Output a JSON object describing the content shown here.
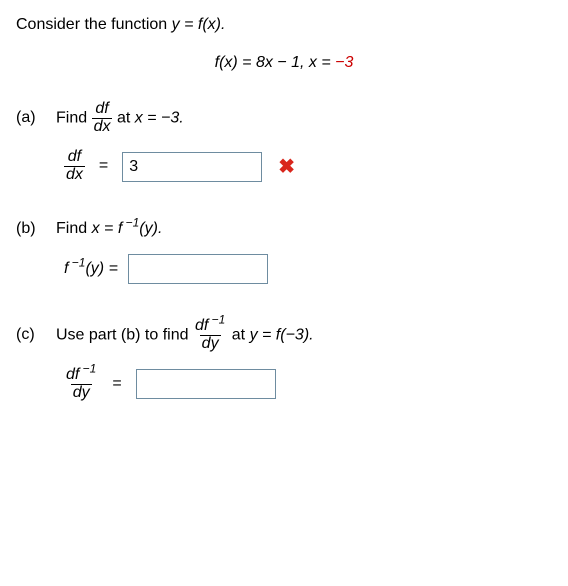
{
  "prompt": "Consider the function ",
  "prompt_fn": "y = f(x).",
  "equation": {
    "lhs": "f(x) = 8x − 1, ",
    "x_lhs": "x = ",
    "x_val": "−3"
  },
  "partA": {
    "label": "(a)",
    "text1": "Find ",
    "frac_num": "df",
    "frac_den": "dx",
    "text2": " at ",
    "at": "x = −3.",
    "ans_frac_num": "df",
    "ans_frac_den": "dx",
    "eq": "=",
    "value": "3"
  },
  "partB": {
    "label": "(b)",
    "text1": "Find ",
    "eq_stmt": "x = f ⁻¹(y).",
    "ans_lhs_pre": "f",
    "ans_lhs_sup": " −1",
    "ans_lhs_post": "(y) =",
    "value": ""
  },
  "partC": {
    "label": "(c)",
    "text1": "Use part (b) to find ",
    "frac_num_pre": "df",
    "frac_num_sup": " −1",
    "frac_den": "dy",
    "text2": " at ",
    "at": "y = f(−3).",
    "ans_frac_num_pre": "df",
    "ans_frac_num_sup": " −1",
    "ans_frac_den": "dy",
    "eq": "=",
    "value": ""
  }
}
